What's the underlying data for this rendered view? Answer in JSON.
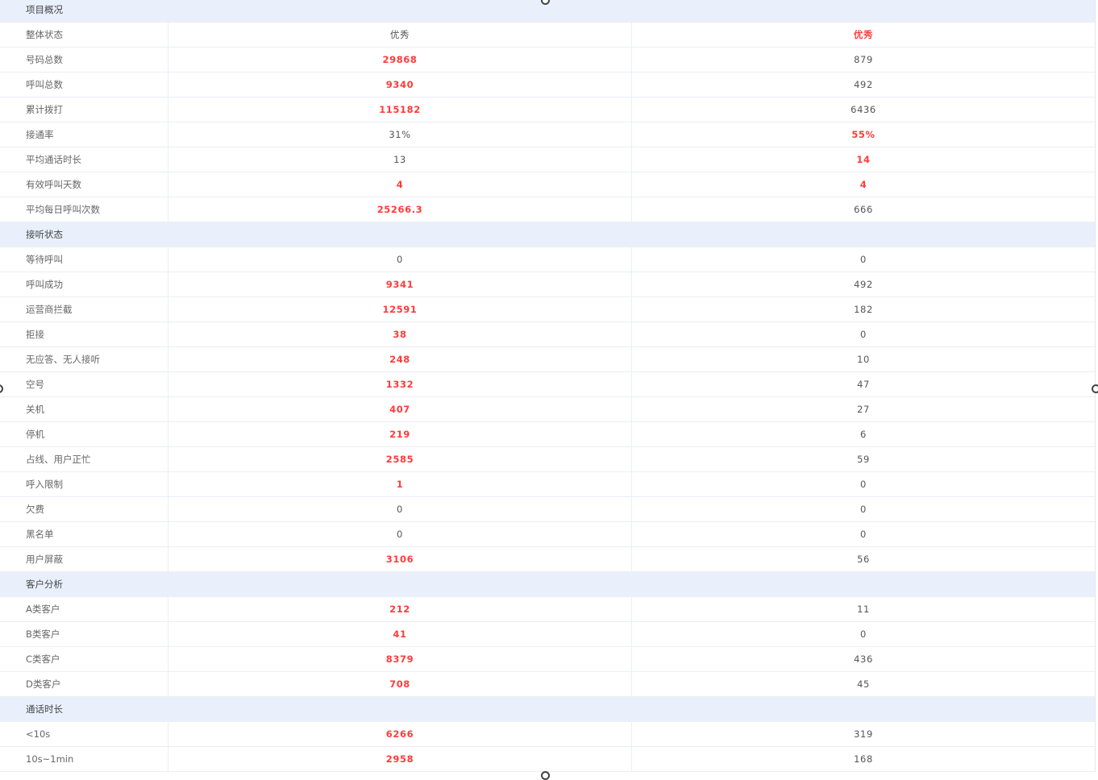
{
  "sections": [
    {
      "title": "项目概况",
      "rows": [
        {
          "label": "整体状态",
          "v1": "优秀",
          "v2": "优秀",
          "hl1": false,
          "hl2": true
        },
        {
          "label": "号码总数",
          "v1": "29868",
          "v2": "879",
          "hl1": true,
          "hl2": false
        },
        {
          "label": "呼叫总数",
          "v1": "9340",
          "v2": "492",
          "hl1": true,
          "hl2": false
        },
        {
          "label": "累计拨打",
          "v1": "115182",
          "v2": "6436",
          "hl1": true,
          "hl2": false
        },
        {
          "label": "接通率",
          "v1": "31%",
          "v2": "55%",
          "hl1": false,
          "hl2": true
        },
        {
          "label": "平均通话时长",
          "v1": "13",
          "v2": "14",
          "hl1": false,
          "hl2": true
        },
        {
          "label": "有效呼叫天数",
          "v1": "4",
          "v2": "4",
          "hl1": true,
          "hl2": true
        },
        {
          "label": "平均每日呼叫次数",
          "v1": "25266.3",
          "v2": "666",
          "hl1": true,
          "hl2": false
        }
      ]
    },
    {
      "title": "接听状态",
      "rows": [
        {
          "label": "等待呼叫",
          "v1": "0",
          "v2": "0",
          "hl1": false,
          "hl2": false
        },
        {
          "label": "呼叫成功",
          "v1": "9341",
          "v2": "492",
          "hl1": true,
          "hl2": false
        },
        {
          "label": "运营商拦截",
          "v1": "12591",
          "v2": "182",
          "hl1": true,
          "hl2": false
        },
        {
          "label": "拒接",
          "v1": "38",
          "v2": "0",
          "hl1": true,
          "hl2": false
        },
        {
          "label": "无应答、无人接听",
          "v1": "248",
          "v2": "10",
          "hl1": true,
          "hl2": false
        },
        {
          "label": "空号",
          "v1": "1332",
          "v2": "47",
          "hl1": true,
          "hl2": false
        },
        {
          "label": "关机",
          "v1": "407",
          "v2": "27",
          "hl1": true,
          "hl2": false
        },
        {
          "label": "停机",
          "v1": "219",
          "v2": "6",
          "hl1": true,
          "hl2": false
        },
        {
          "label": "占线、用户正忙",
          "v1": "2585",
          "v2": "59",
          "hl1": true,
          "hl2": false
        },
        {
          "label": "呼入限制",
          "v1": "1",
          "v2": "0",
          "hl1": true,
          "hl2": false
        },
        {
          "label": "欠费",
          "v1": "0",
          "v2": "0",
          "hl1": false,
          "hl2": false
        },
        {
          "label": "黑名单",
          "v1": "0",
          "v2": "0",
          "hl1": false,
          "hl2": false
        },
        {
          "label": "用户屏蔽",
          "v1": "3106",
          "v2": "56",
          "hl1": true,
          "hl2": false
        }
      ]
    },
    {
      "title": "客户分析",
      "rows": [
        {
          "label": "A类客户",
          "v1": "212",
          "v2": "11",
          "hl1": true,
          "hl2": false
        },
        {
          "label": "B类客户",
          "v1": "41",
          "v2": "0",
          "hl1": true,
          "hl2": false
        },
        {
          "label": "C类客户",
          "v1": "8379",
          "v2": "436",
          "hl1": true,
          "hl2": false
        },
        {
          "label": "D类客户",
          "v1": "708",
          "v2": "45",
          "hl1": true,
          "hl2": false
        }
      ]
    },
    {
      "title": "通话时长",
      "rows": [
        {
          "label": "<10s",
          "v1": "6266",
          "v2": "319",
          "hl1": true,
          "hl2": false
        },
        {
          "label": "10s~1min",
          "v1": "2958",
          "v2": "168",
          "hl1": true,
          "hl2": false
        }
      ]
    }
  ],
  "colors": {
    "highlight": "#ff3b3b",
    "section_bg": "#e9f0fc",
    "text": "#555555",
    "border": "#ebeef5"
  }
}
